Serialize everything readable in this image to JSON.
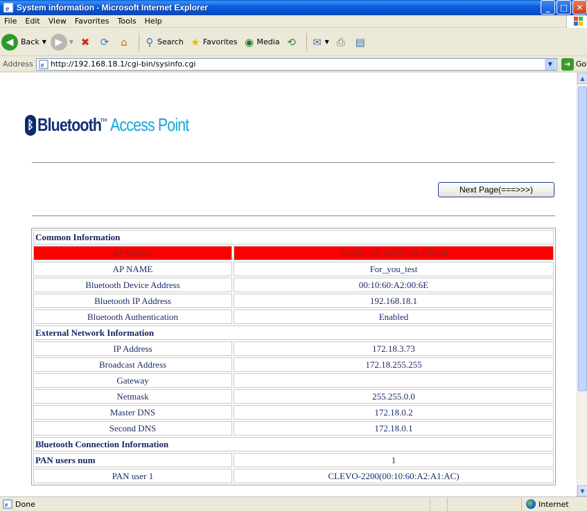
{
  "window": {
    "title": "System information - Microsoft Internet Explorer"
  },
  "menu": [
    "File",
    "Edit",
    "View",
    "Favorites",
    "Tools",
    "Help"
  ],
  "toolbar": {
    "back": "Back",
    "search": "Search",
    "favorites": "Favorites",
    "media": "Media"
  },
  "address": {
    "label": "Address",
    "url": "http://192.168.18.1/cgi-bin/sysinfo.cgi",
    "go": "Go"
  },
  "logo": {
    "bluetooth": "Bluetooth",
    "tm": "TM",
    "access_point": "Access Point"
  },
  "next_button": "Next Page(===>>>)",
  "sections": [
    {
      "title": "Common Information",
      "rows": [
        {
          "label": "AP Version",
          "value": "PAN&LAP AP-01.08-250304",
          "highlight": true
        },
        {
          "label": "AP NAME",
          "value": "For_you_test"
        },
        {
          "label": "Bluetooth Device Address",
          "value": "00:10:60:A2:00:6E"
        },
        {
          "label": "Bluetooth IP Address",
          "value": "192.168.18.1"
        },
        {
          "label": "Bluetooth Authentication",
          "value": "Enabled"
        }
      ]
    },
    {
      "title": "External Network Information",
      "rows": [
        {
          "label": "IP Address",
          "value": "172.18.3.73"
        },
        {
          "label": "Broadcast Address",
          "value": "172.18.255.255"
        },
        {
          "label": "Gateway",
          "value": ""
        },
        {
          "label": "Netmask",
          "value": "255.255.0.0"
        },
        {
          "label": "Master DNS",
          "value": "172.18.0.2"
        },
        {
          "label": "Second DNS",
          "value": "172.18.0.1"
        }
      ]
    },
    {
      "title": "Bluetooth Connection Information",
      "rows": []
    }
  ],
  "pan": {
    "users_num_label": "PAN users num",
    "users_num_value": "1",
    "user1_label": "PAN user 1",
    "user1_value": "CLEVO-2200(00:10:60:A2:A1:AC)"
  },
  "status": {
    "text": "Done",
    "zone": "Internet"
  }
}
